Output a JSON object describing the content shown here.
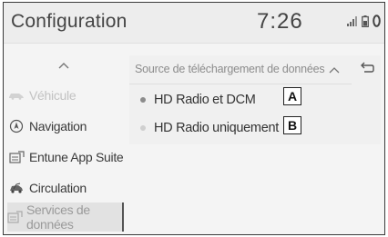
{
  "header": {
    "title": "Configuration",
    "clock": "7:26",
    "status_icons": [
      "signal-bars-icon",
      "phone-battery-icon",
      "bluetooth-connection-icon"
    ]
  },
  "sidebar": {
    "items": [
      {
        "label": "Véhicule",
        "icon": "car-icon",
        "state": "disabled"
      },
      {
        "label": "Navigation",
        "icon": "navigation-compass-icon",
        "state": "normal"
      },
      {
        "label": "Entune App Suite",
        "icon": "app-suite-icon",
        "state": "normal"
      },
      {
        "label": "Circulation",
        "icon": "traffic-car-icon",
        "state": "normal"
      },
      {
        "label": "Services de données",
        "icon": "data-services-icon",
        "state": "selected"
      }
    ]
  },
  "panel": {
    "title": "Source de téléchargement de données",
    "options": [
      {
        "label": "HD Radio et DCM",
        "callout": "A",
        "state": "active"
      },
      {
        "label": "HD Radio uniquement",
        "callout": "B",
        "state": "inactive"
      }
    ]
  },
  "colors": {
    "active_dot": "#8c8c8c",
    "inactive_dot": "#cfcfcf",
    "text": "#333333",
    "muted_text": "#8c8c8c"
  }
}
